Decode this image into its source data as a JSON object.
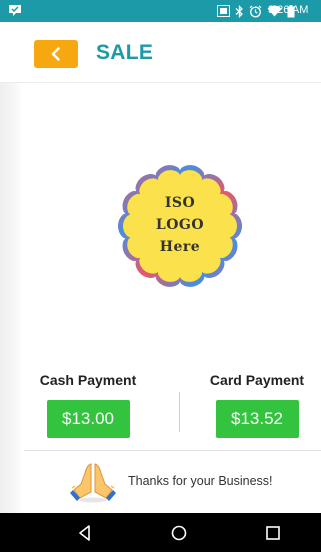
{
  "status_bar": {
    "time": "3:26 AM",
    "icons": [
      "notification-icon",
      "nfc-icon",
      "bluetooth-icon",
      "alarm-icon",
      "wifi-icon",
      "battery-icon"
    ]
  },
  "app_bar": {
    "back_icon": "chevron-left-icon",
    "title": "SALE"
  },
  "logo": {
    "line1": "ISO",
    "line2": "LOGO",
    "line3": "Here"
  },
  "payments": {
    "cash": {
      "label": "Cash Payment",
      "amount": "$13.00"
    },
    "card": {
      "label": "Card Payment",
      "amount": "$13.52"
    }
  },
  "footer": {
    "icon": "praying-hands-icon",
    "message": "Thanks for your Business!"
  },
  "nav_bar": {
    "buttons": [
      "back-triangle-icon",
      "home-circle-icon",
      "recents-square-icon"
    ]
  },
  "colors": {
    "status_bar": "#1c9aa8",
    "title": "#1c9aa8",
    "back_button": "#f5a80f",
    "amount_button": "#33c33f",
    "logo_fill": "#fbe14b",
    "logo_blue": "#4a8de0",
    "logo_red": "#e8576a"
  }
}
